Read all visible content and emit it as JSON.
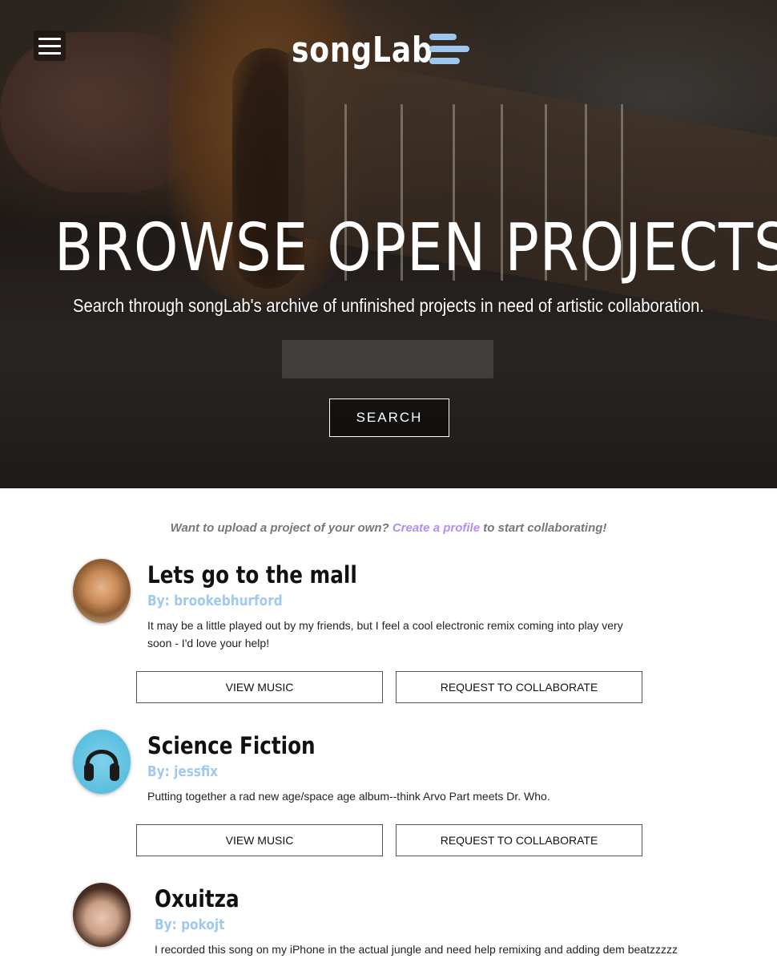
{
  "header": {
    "logo_text": "songLab",
    "menu_icon": "hamburger-menu-icon",
    "logo_icon": "bars-icon",
    "logo_icon_color": "#9cc8f0"
  },
  "hero": {
    "title": "BROWSE OPEN PROJECTS",
    "subtitle": "Search through songLab's archive of unfinished projects in need of artistic collaboration.",
    "search": {
      "value": "",
      "placeholder": ""
    },
    "search_button_label": "SEARCH"
  },
  "upload_prompt": {
    "before": "Want to upload a project of your own? ",
    "link_text": "Create a profile",
    "after": " to start collaborating!",
    "link_color": "#b28ff0"
  },
  "projects": [
    {
      "title": "Lets go to the mall",
      "author": "By: brookebhurford",
      "description": "It may be a little played out by my friends, but I feel a cool electronic remix coming into play very soon - I'd love your help!",
      "view_label": "VIEW MUSIC",
      "collab_label": "REQUEST TO COLLABORATE"
    },
    {
      "title": "Science Fiction",
      "author": "By: jessfix",
      "description": "Putting together a rad new age/space age album--think Arvo Part meets Dr. Who.",
      "view_label": "VIEW MUSIC",
      "collab_label": "REQUEST TO COLLABORATE"
    },
    {
      "title": "Oxuitza",
      "author": "By: pokojt",
      "description": "I recorded this song on my iPhone in the actual jungle and need help remixing and adding dem beatzzzzz"
    }
  ],
  "colors": {
    "author_blue": "#9fc9ee",
    "prompt_gray": "#777777"
  }
}
